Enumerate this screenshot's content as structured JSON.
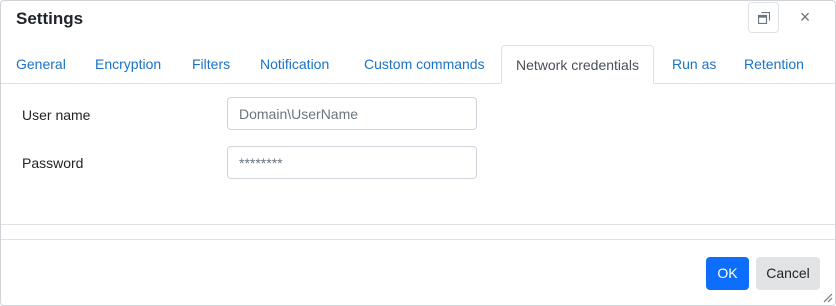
{
  "dialog": {
    "title": "Settings",
    "close_glyph": "×"
  },
  "tabs": [
    {
      "label": "General"
    },
    {
      "label": "Encryption"
    },
    {
      "label": "Filters"
    },
    {
      "label": "Notification"
    },
    {
      "label": "Custom commands"
    },
    {
      "label": "Network credentials",
      "active": true
    },
    {
      "label": "Run as"
    },
    {
      "label": "Retention"
    }
  ],
  "form": {
    "username_label": "User name",
    "username_placeholder": "Domain\\UserName",
    "password_label": "Password",
    "password_placeholder": "********"
  },
  "footer": {
    "ok_label": "OK",
    "cancel_label": "Cancel"
  },
  "colors": {
    "primary": "#0d6efd",
    "tab_link": "#1a73c8"
  }
}
